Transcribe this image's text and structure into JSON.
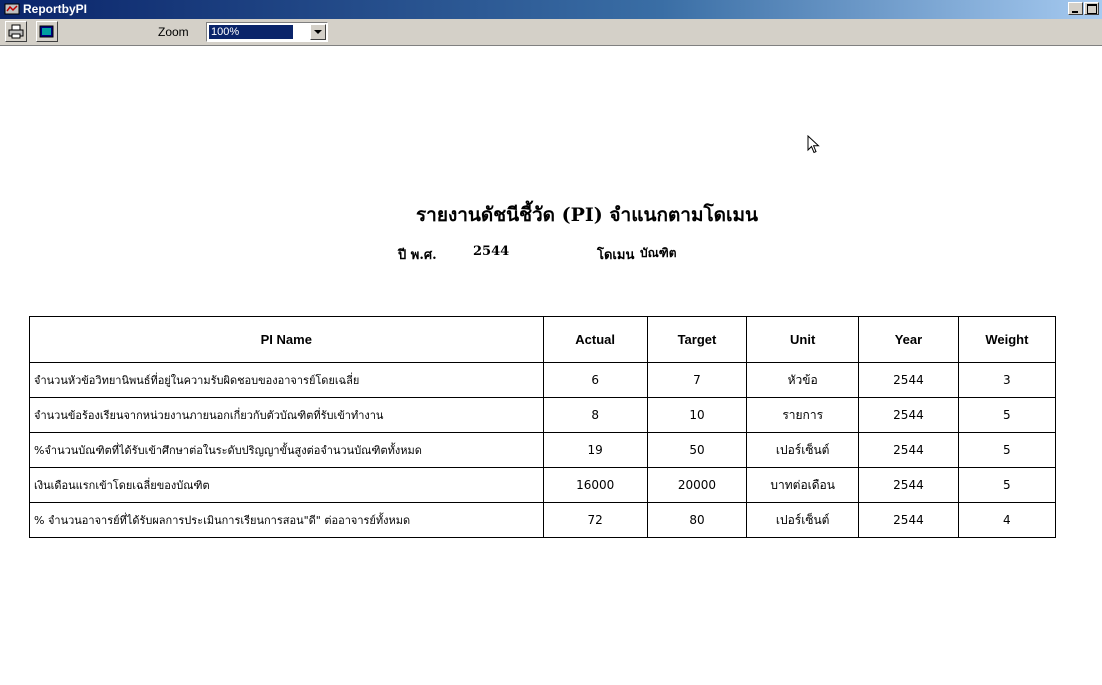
{
  "window": {
    "title": "ReportbyPI"
  },
  "toolbar": {
    "print_icon": "printer-icon",
    "export_icon": "export-icon",
    "zoom_label": "Zoom",
    "zoom_value": "100%"
  },
  "report": {
    "title": "รายงานดัชนีชี้วัด (PI) จำแนกตามโดเมน",
    "year_label": "ปี พ.ศ.",
    "year_value": "2544",
    "domain_label": "โดเมน",
    "domain_value": "บัณฑิต"
  },
  "table": {
    "headers": {
      "name": "PI Name",
      "actual": "Actual",
      "target": "Target",
      "unit": "Unit",
      "year": "Year",
      "weight": "Weight"
    },
    "rows": [
      {
        "name": "จำนวนหัวข้อวิทยานิพนธ์ที่อยู่ในความรับผิดชอบของอาจารย์โดยเฉลี่ย",
        "actual": "6",
        "target": "7",
        "unit": "หัวข้อ",
        "year": "2544",
        "weight": "3"
      },
      {
        "name": "จำนวนข้อร้องเรียนจากหน่วยงานภายนอกเกี่ยวกับตัวบัณฑิตที่รับเข้าทำงาน",
        "actual": "8",
        "target": "10",
        "unit": "รายการ",
        "year": "2544",
        "weight": "5"
      },
      {
        "name": "%จำนวนบัณฑิตที่ได้รับเข้าศึกษาต่อในระดับปริญญาขั้นสูงต่อจำนวนบัณฑิตทั้งหมด",
        "actual": "19",
        "target": "50",
        "unit": "เปอร์เซ็นต์",
        "year": "2544",
        "weight": "5"
      },
      {
        "name": "เงินเดือนแรกเข้าโดยเฉลี่ยของบัณฑิต",
        "actual": "16000",
        "target": "20000",
        "unit": "บาทต่อเดือน",
        "year": "2544",
        "weight": "5"
      },
      {
        "name": "% จำนวนอาจารย์ที่ได้รับผลการประเมินการเรียนการสอน\"ดี\" ต่ออาจารย์ทั้งหมด",
        "actual": "72",
        "target": "80",
        "unit": "เปอร์เซ็นต์",
        "year": "2544",
        "weight": "4"
      }
    ]
  },
  "colors": {
    "titlebar_start": "#0a246a",
    "titlebar_end": "#a6caf0",
    "chrome": "#d4d0c8"
  }
}
